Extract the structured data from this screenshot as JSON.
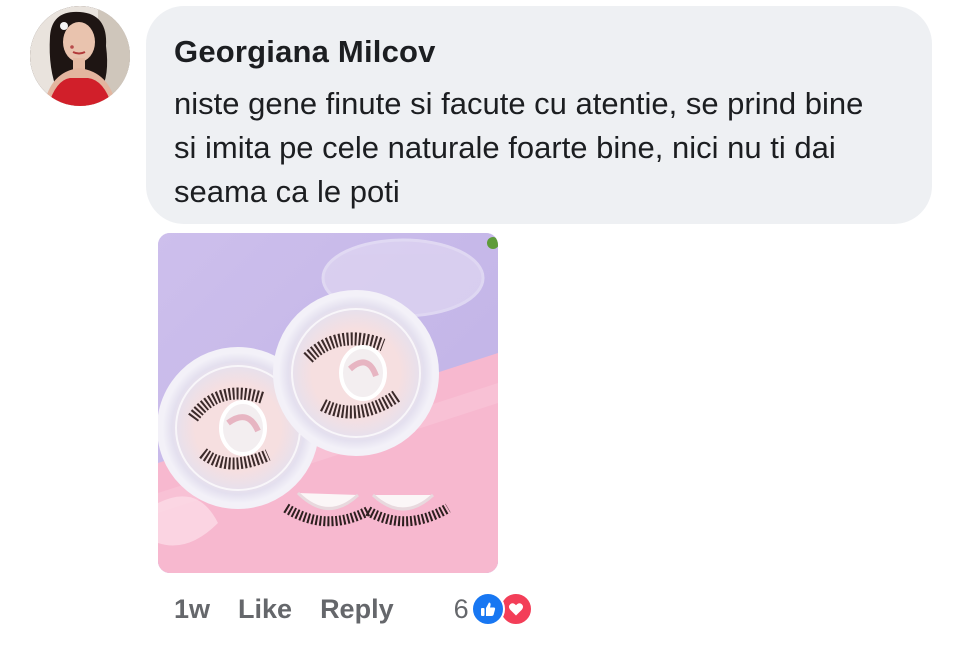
{
  "comment": {
    "author": "Georgiana Milcov",
    "text": "niste gene finute si facute cu atentie, se prind bine si imita pe cele naturale foarte bine, nici nu ti dai seama ca le poti",
    "avatar_icon": "profile-photo",
    "image_icon": "attached-photo-false-eyelashes"
  },
  "actions": {
    "time": "1w",
    "like_label": "Like",
    "reply_label": "Reply"
  },
  "reactions": {
    "count": "6",
    "icons": [
      "like-reaction-icon",
      "love-reaction-icon"
    ],
    "colors": {
      "like": "#1877f2",
      "love": "#f33e58"
    }
  }
}
